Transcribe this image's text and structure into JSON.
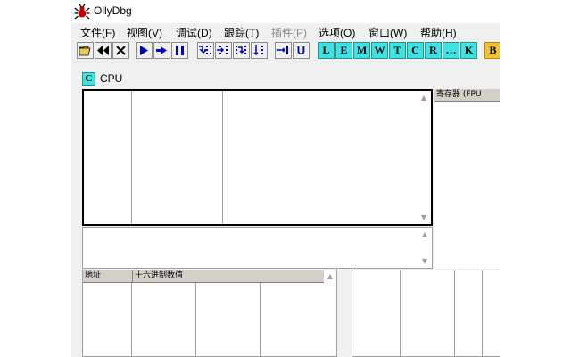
{
  "window": {
    "title": "OllyDbg"
  },
  "menu": [
    {
      "label": "文件(F)",
      "enabled": true
    },
    {
      "label": "视图(V)",
      "enabled": true
    },
    {
      "label": "调试(D)",
      "enabled": true
    },
    {
      "label": "跟踪(T)",
      "enabled": true
    },
    {
      "label": "插件(P)",
      "enabled": false
    },
    {
      "label": "选项(O)",
      "enabled": true
    },
    {
      "label": "窗口(W)",
      "enabled": true
    },
    {
      "label": "帮助(H)",
      "enabled": true
    }
  ],
  "toolbar": {
    "buttons": [
      {
        "icon": "open-folder-icon"
      },
      {
        "icon": "restart-icon"
      },
      {
        "icon": "close-icon"
      },
      {
        "icon": "run-icon"
      },
      {
        "icon": "run-thread-icon"
      },
      {
        "icon": "pause-icon"
      },
      {
        "icon": "step-into-icon"
      },
      {
        "icon": "step-over-icon"
      },
      {
        "icon": "trace-into-icon"
      },
      {
        "icon": "trace-over-icon"
      },
      {
        "icon": "execute-till-return-icon"
      },
      {
        "icon": "execute-till-user-code-icon"
      }
    ],
    "window_letters": [
      "L",
      "E",
      "M",
      "W",
      "T",
      "C",
      "R",
      "…",
      "K",
      "B"
    ],
    "colors": {
      "letter_bg": "#3ee2e2",
      "letter_bg_active": "#f1c232",
      "button_glyph": "#0000c8"
    }
  },
  "cpu_window": {
    "icon_letter": "C",
    "title": "CPU",
    "registers_header": "寄存器 (FPU",
    "dump_headers": {
      "address": "地址",
      "hex": "十六进制数值"
    }
  }
}
